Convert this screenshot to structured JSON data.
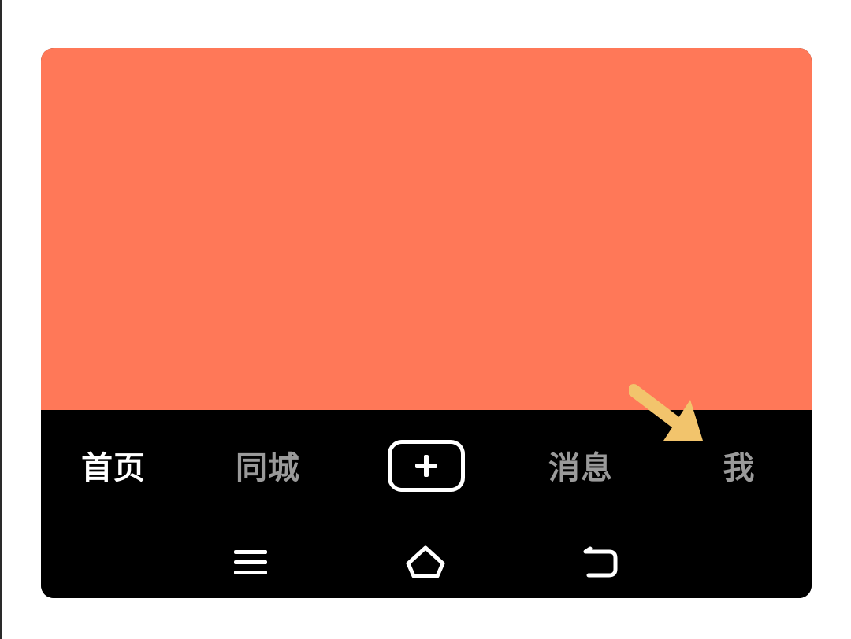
{
  "colors": {
    "content_background": "#FF7858",
    "tab_bar_background": "#000000",
    "tab_active": "#FFFFFF",
    "tab_inactive": "#9A9A9A",
    "annotation_arrow": "#F2C46C",
    "page_background": "#FFFFFF"
  },
  "tab_bar": {
    "tabs": [
      {
        "label": "首页",
        "active": true
      },
      {
        "label": "同城",
        "active": false
      },
      {
        "label": "消息",
        "active": false
      },
      {
        "label": "我",
        "active": false
      }
    ],
    "create_button_icon": "plus-icon"
  },
  "annotation": {
    "icon": "arrow-pointing-icon",
    "target": "我"
  },
  "system_nav": {
    "buttons": [
      {
        "icon": "menu-icon"
      },
      {
        "icon": "home-outline-icon"
      },
      {
        "icon": "back-icon"
      }
    ]
  }
}
